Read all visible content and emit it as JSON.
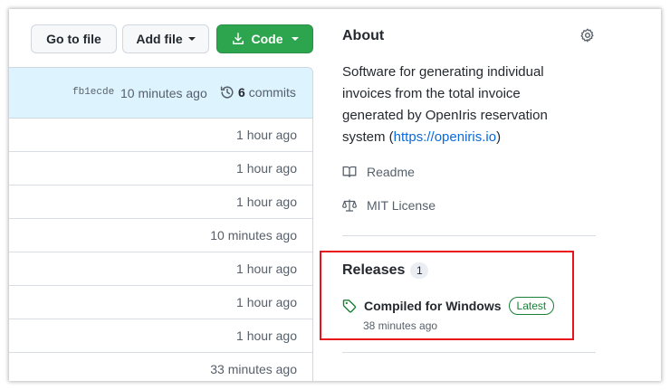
{
  "toolbar": {
    "go_to_file": "Go to file",
    "add_file": "Add file",
    "code": "Code"
  },
  "commit_bar": {
    "sha": "fb1ecde",
    "time": "10 minutes ago",
    "commit_count": "6",
    "commit_label": "commits"
  },
  "file_rows": [
    {
      "time": "1 hour ago"
    },
    {
      "time": "1 hour ago"
    },
    {
      "time": "1 hour ago"
    },
    {
      "time": "10 minutes ago"
    },
    {
      "time": "1 hour ago"
    },
    {
      "time": "1 hour ago"
    },
    {
      "time": "1 hour ago"
    },
    {
      "time": "33 minutes ago"
    }
  ],
  "about": {
    "title": "About",
    "description": "Software for generating individual invoices from the total invoice generated by OpenIris reservation system (",
    "link_text": "https://openiris.io",
    "description_end": ")",
    "readme": "Readme",
    "license": "MIT License"
  },
  "releases": {
    "title": "Releases",
    "count": "1",
    "release_name": "Compiled for Windows",
    "badge": "Latest",
    "time": "38 minutes ago"
  },
  "colors": {
    "code_button": "#2da44e",
    "link": "#0969da",
    "latest_badge": "#1a7f37",
    "highlight_box": "#e8141a",
    "commit_bar_bg": "#ddf4ff"
  },
  "icons": {
    "code_button": "download-icon",
    "commits": "history-icon",
    "about_settings": "gear-icon",
    "readme": "book-icon",
    "license": "law-icon",
    "release": "tag-icon"
  }
}
